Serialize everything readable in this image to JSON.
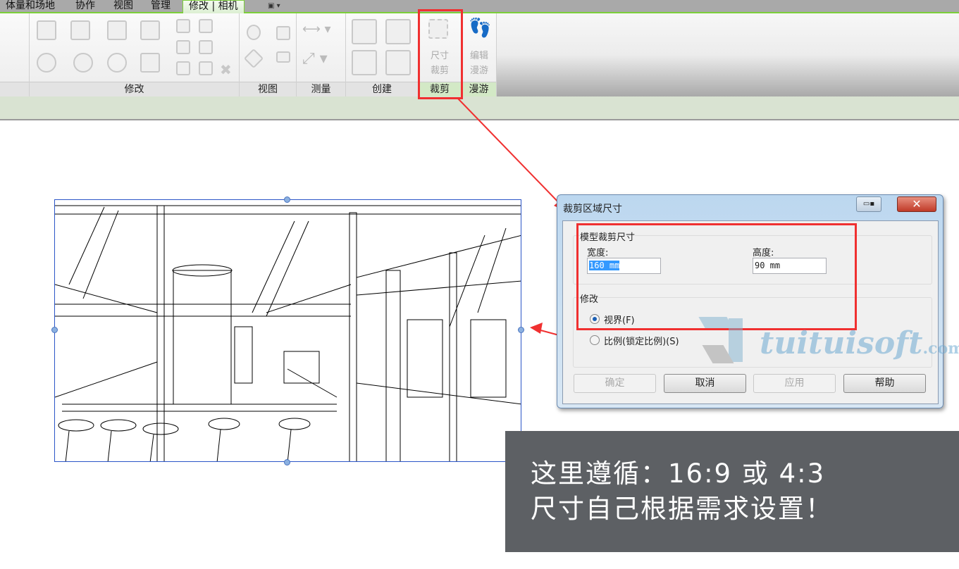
{
  "tabs": [
    {
      "label": "体量和场地"
    },
    {
      "label": "协作"
    },
    {
      "label": "视图"
    },
    {
      "label": "管理"
    },
    {
      "label": "修改 | 相机",
      "active": true
    }
  ],
  "ribbon": {
    "panels": [
      {
        "label": "修改"
      },
      {
        "label": "视图"
      },
      {
        "label": "测量"
      },
      {
        "label": "创建"
      },
      {
        "label": "裁剪"
      },
      {
        "label": "漫游"
      }
    ],
    "crop_button": {
      "line1": "尺寸",
      "line2": "裁剪"
    },
    "walk_button": {
      "line1": "编辑",
      "line2": "漫游"
    }
  },
  "dialog": {
    "title": "裁剪区域尺寸",
    "group_size": "模型裁剪尺寸",
    "width_label": "宽度:",
    "width_value": "160 mm",
    "height_label": "高度:",
    "height_value": "90 mm",
    "group_modify": "修改",
    "radio_field": "视界(F)",
    "radio_scale": "比例(锁定比例)(S)",
    "buttons": {
      "ok": "确定",
      "cancel": "取消",
      "apply": "应用",
      "help": "帮助"
    }
  },
  "watermark": {
    "text": "tuituisoft",
    "suffix": ".com"
  },
  "note": {
    "line1": "这里遵循：16:9 或 4:3",
    "line2": "尺寸自己根据需求设置！"
  },
  "colors": {
    "highlight": "#f03030",
    "accent": "#7ccf3a",
    "selection": "#3399ff"
  }
}
